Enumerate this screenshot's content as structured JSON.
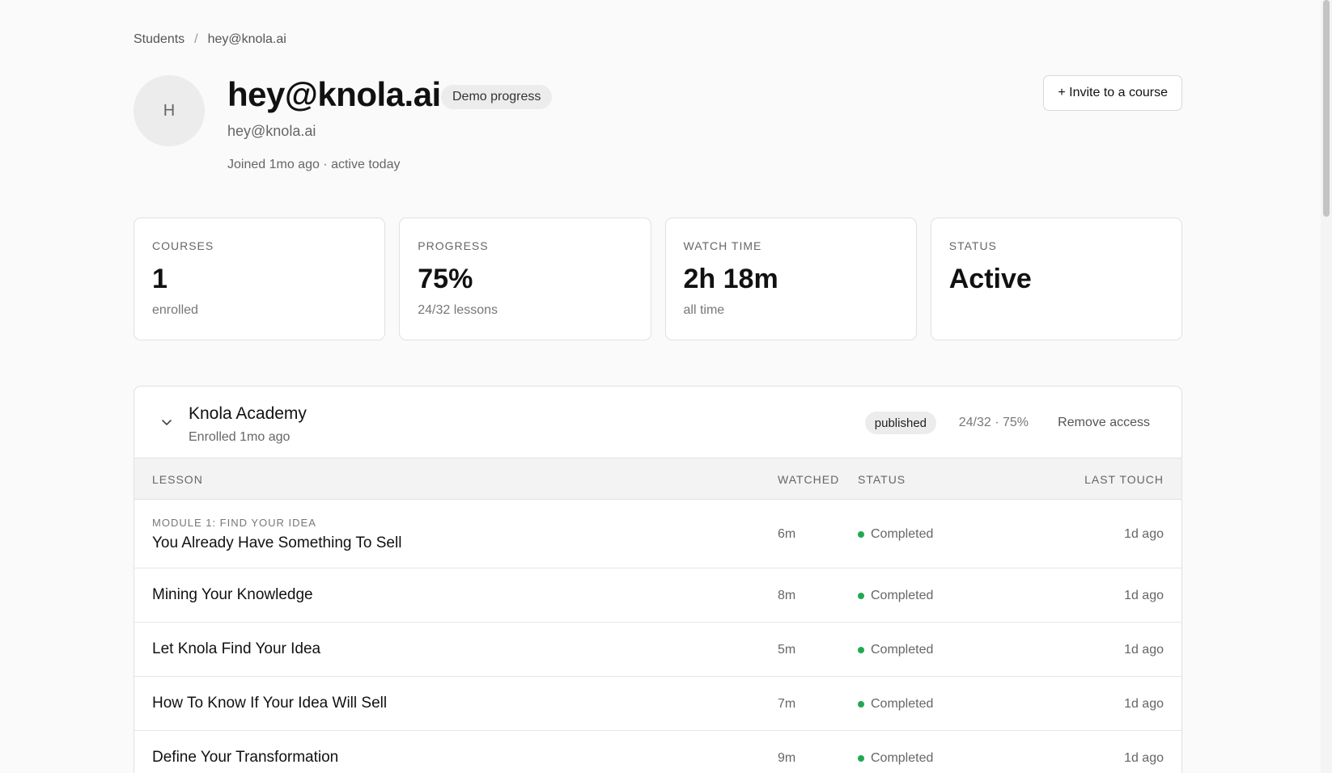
{
  "breadcrumb": {
    "parent": "Students",
    "separator": "/",
    "current": "hey@knola.ai"
  },
  "profile": {
    "avatar_initial": "H",
    "name": "hey@knola.ai",
    "badge": "Demo progress",
    "email": "hey@knola.ai",
    "joined": "Joined 1mo ago · active today"
  },
  "actions": {
    "invite_label": "+ Invite to a course"
  },
  "stats": [
    {
      "label": "COURSES",
      "value": "1",
      "sub": "enrolled"
    },
    {
      "label": "PROGRESS",
      "value": "75%",
      "sub": "24/32 lessons"
    },
    {
      "label": "WATCH TIME",
      "value": "2h 18m",
      "sub": "all time"
    },
    {
      "label": "STATUS",
      "value": "Active",
      "sub": ""
    }
  ],
  "course": {
    "title": "Knola Academy",
    "enrolled": "Enrolled 1mo ago",
    "badge": "published",
    "progress": "24/32 · 75%",
    "remove_label": "Remove access",
    "columns": {
      "lesson": "LESSON",
      "watched": "WATCHED",
      "status": "STATUS",
      "last_touch": "LAST TOUCH"
    },
    "lessons": [
      {
        "module": "MODULE 1: FIND YOUR IDEA",
        "title": "You Already Have Something To Sell",
        "watched": "6m",
        "status": "Completed",
        "last_touch": "1d ago"
      },
      {
        "module": "",
        "title": "Mining Your Knowledge",
        "watched": "8m",
        "status": "Completed",
        "last_touch": "1d ago"
      },
      {
        "module": "",
        "title": "Let Knola Find Your Idea",
        "watched": "5m",
        "status": "Completed",
        "last_touch": "1d ago"
      },
      {
        "module": "",
        "title": "How To Know If Your Idea Will Sell",
        "watched": "7m",
        "status": "Completed",
        "last_touch": "1d ago"
      },
      {
        "module": "",
        "title": "Define Your Transformation",
        "watched": "9m",
        "status": "Completed",
        "last_touch": "1d ago"
      }
    ]
  },
  "colors": {
    "status_completed": "#22a852",
    "badge_bg": "#ececec"
  },
  "icons": {
    "expand": "chevron-down-icon"
  }
}
